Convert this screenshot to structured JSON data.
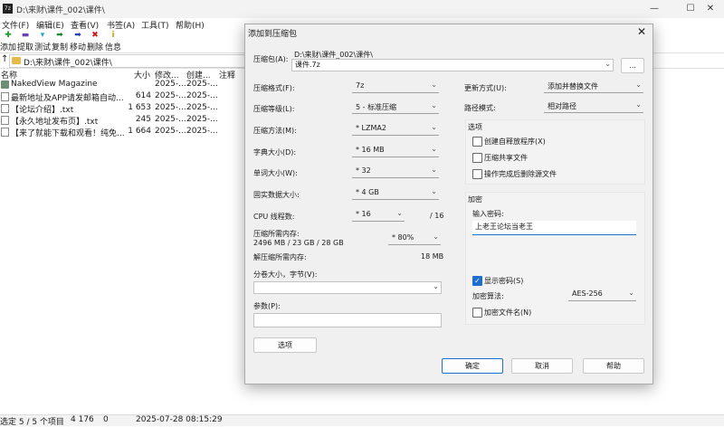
{
  "window": {
    "title": "D:\\来财\\课件_002\\课件\\",
    "controls": [
      "—",
      "☐",
      "✕"
    ]
  },
  "menu": [
    "文件(F)",
    "编辑(E)",
    "查看(V)",
    "书签(A)",
    "工具(T)",
    "帮助(H)"
  ],
  "toolbar": [
    {
      "label": "添加",
      "icon": "✚",
      "color": "#1b9a2b"
    },
    {
      "label": "提取",
      "icon": "▬",
      "color": "#6a3fb5"
    },
    {
      "label": "测试",
      "icon": "▾",
      "color": "#20a4c4"
    },
    {
      "label": "复制",
      "icon": "➡",
      "color": "#1c8b2c"
    },
    {
      "label": "移动",
      "icon": "➡",
      "color": "#2240b0"
    },
    {
      "label": "删除",
      "icon": "✖",
      "color": "#d01818"
    },
    {
      "label": "信息",
      "icon": "i",
      "color": "#c8a018"
    }
  ],
  "address": {
    "up": "↑",
    "path": "D:\\来财\\课件_002\\课件\\"
  },
  "columns": [
    "名称",
    "大小",
    "修改...",
    "创建...",
    "注释"
  ],
  "files": [
    {
      "name": "NakedView Magazine",
      "size": "",
      "modified": "2025-...",
      "created": "2025-...",
      "type": "folder"
    },
    {
      "name": "最新地址及APP请发邮箱自动...",
      "size": "614",
      "modified": "2025-...",
      "created": "2025-...",
      "type": "file"
    },
    {
      "name": "【论坛介绍】.txt",
      "size": "1 653",
      "modified": "2025-...",
      "created": "2025-...",
      "type": "file"
    },
    {
      "name": "【永久地址发布页】.txt",
      "size": "245",
      "modified": "2025-...",
      "created": "2025-...",
      "type": "file"
    },
    {
      "name": "【来了就能下载和观看！纯免...",
      "size": "1 664",
      "modified": "2025-...",
      "created": "2025-...",
      "type": "file"
    }
  ],
  "status": {
    "selection": "选定 5 / 5 个项目",
    "size": "4 176",
    "packed": "0",
    "datetime": "2025-07-28 08:15:29"
  },
  "dialog": {
    "title": "添加到压缩包",
    "archive_label": "压缩包(A):",
    "archive_path": "D:\\来财\\课件_002\\课件\\",
    "archive_name": "课件.7z",
    "browse": "...",
    "format_label": "压缩格式(F):",
    "format_value": "7z",
    "level_label": "压缩等级(L):",
    "level_value": "5 - 标准压缩",
    "method_label": "压缩方法(M):",
    "method_value": "* LZMA2",
    "dict_label": "字典大小(D):",
    "dict_value": "* 16 MB",
    "word_label": "单词大小(W):",
    "word_value": "* 32",
    "solid_label": "固实数据大小:",
    "solid_value": "* 4 GB",
    "threads_label": "CPU 线程数:",
    "threads_value": "* 16",
    "threads_total": "/ 16",
    "mem_label": "压缩所需内存:",
    "mem_value": "2496 MB / 23 GB / 28 GB",
    "mem_percent": "* 80%",
    "decomp_label": "解压缩所需内存:",
    "decomp_value": "18 MB",
    "split_label": "分卷大小，字节(V):",
    "split_value": "",
    "params_label": "参数(P):",
    "params_value": "",
    "options_button": "选项",
    "update_label": "更新方式(U):",
    "update_value": "添加并替换文件",
    "pathmode_label": "路径模式:",
    "pathmode_value": "相对路径",
    "options_group": "选项",
    "opt_sfx": "创建自释放程序(X)",
    "opt_shared": "压缩共享文件",
    "opt_delete": "操作完成后删除源文件",
    "encrypt_group": "加密",
    "password_label": "输入密码:",
    "password_value": "上老王论坛当老王",
    "show_password": "显示密码(S)",
    "enc_method_label": "加密算法:",
    "enc_method_value": "AES-256",
    "encrypt_names": "加密文件名(N)",
    "ok": "确定",
    "cancel": "取消",
    "help": "帮助"
  }
}
